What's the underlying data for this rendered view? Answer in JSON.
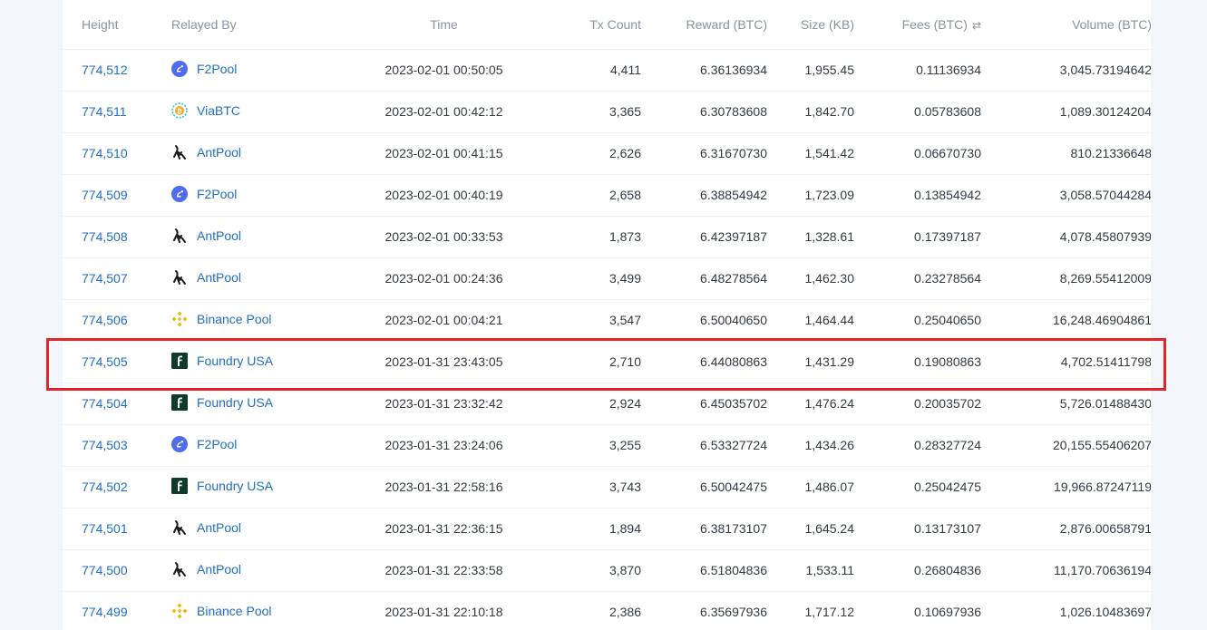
{
  "table": {
    "headers": {
      "height": "Height",
      "relayed_by": "Relayed By",
      "time": "Time",
      "tx_count": "Tx Count",
      "reward": "Reward (BTC)",
      "size": "Size (KB)",
      "fees": "Fees (BTC)",
      "volume": "Volume (BTC)"
    },
    "fees_sort_icon": "swap-arrows-icon",
    "highlighted_row_height": "774,505",
    "highlight_color": "#e0242c",
    "link_color": "#1f6fc5",
    "rows": [
      {
        "height": "774,512",
        "pool": "F2Pool",
        "pool_icon": "f2pool-icon",
        "time": "2023-02-01 00:50:05",
        "tx_count": "4,411",
        "reward": "6.36136934",
        "size": "1,955.45",
        "fees": "0.11136934",
        "volume": "3,045.73194642"
      },
      {
        "height": "774,511",
        "pool": "ViaBTC",
        "pool_icon": "viabtc-icon",
        "time": "2023-02-01 00:42:12",
        "tx_count": "3,365",
        "reward": "6.30783608",
        "size": "1,842.70",
        "fees": "0.05783608",
        "volume": "1,089.30124204"
      },
      {
        "height": "774,510",
        "pool": "AntPool",
        "pool_icon": "antpool-icon",
        "time": "2023-02-01 00:41:15",
        "tx_count": "2,626",
        "reward": "6.31670730",
        "size": "1,541.42",
        "fees": "0.06670730",
        "volume": "810.21336648"
      },
      {
        "height": "774,509",
        "pool": "F2Pool",
        "pool_icon": "f2pool-icon",
        "time": "2023-02-01 00:40:19",
        "tx_count": "2,658",
        "reward": "6.38854942",
        "size": "1,723.09",
        "fees": "0.13854942",
        "volume": "3,058.57044284"
      },
      {
        "height": "774,508",
        "pool": "AntPool",
        "pool_icon": "antpool-icon",
        "time": "2023-02-01 00:33:53",
        "tx_count": "1,873",
        "reward": "6.42397187",
        "size": "1,328.61",
        "fees": "0.17397187",
        "volume": "4,078.45807939"
      },
      {
        "height": "774,507",
        "pool": "AntPool",
        "pool_icon": "antpool-icon",
        "time": "2023-02-01 00:24:36",
        "tx_count": "3,499",
        "reward": "6.48278564",
        "size": "1,462.30",
        "fees": "0.23278564",
        "volume": "8,269.55412009"
      },
      {
        "height": "774,506",
        "pool": "Binance Pool",
        "pool_icon": "binance-pool-icon",
        "time": "2023-02-01 00:04:21",
        "tx_count": "3,547",
        "reward": "6.50040650",
        "size": "1,464.44",
        "fees": "0.25040650",
        "volume": "16,248.46904861"
      },
      {
        "height": "774,505",
        "pool": "Foundry USA",
        "pool_icon": "foundry-usa-icon",
        "time": "2023-01-31 23:43:05",
        "tx_count": "2,710",
        "reward": "6.44080863",
        "size": "1,431.29",
        "fees": "0.19080863",
        "volume": "4,702.51411798"
      },
      {
        "height": "774,504",
        "pool": "Foundry USA",
        "pool_icon": "foundry-usa-icon",
        "time": "2023-01-31 23:32:42",
        "tx_count": "2,924",
        "reward": "6.45035702",
        "size": "1,476.24",
        "fees": "0.20035702",
        "volume": "5,726.01488430"
      },
      {
        "height": "774,503",
        "pool": "F2Pool",
        "pool_icon": "f2pool-icon",
        "time": "2023-01-31 23:24:06",
        "tx_count": "3,255",
        "reward": "6.53327724",
        "size": "1,434.26",
        "fees": "0.28327724",
        "volume": "20,155.55406207"
      },
      {
        "height": "774,502",
        "pool": "Foundry USA",
        "pool_icon": "foundry-usa-icon",
        "time": "2023-01-31 22:58:16",
        "tx_count": "3,743",
        "reward": "6.50042475",
        "size": "1,486.07",
        "fees": "0.25042475",
        "volume": "19,966.87247119"
      },
      {
        "height": "774,501",
        "pool": "AntPool",
        "pool_icon": "antpool-icon",
        "time": "2023-01-31 22:36:15",
        "tx_count": "1,894",
        "reward": "6.38173107",
        "size": "1,645.24",
        "fees": "0.13173107",
        "volume": "2,876.00658791"
      },
      {
        "height": "774,500",
        "pool": "AntPool",
        "pool_icon": "antpool-icon",
        "time": "2023-01-31 22:33:58",
        "tx_count": "3,870",
        "reward": "6.51804836",
        "size": "1,533.11",
        "fees": "0.26804836",
        "volume": "11,170.70636194"
      },
      {
        "height": "774,499",
        "pool": "Binance Pool",
        "pool_icon": "binance-pool-icon",
        "time": "2023-01-31 22:10:18",
        "tx_count": "2,386",
        "reward": "6.35697936",
        "size": "1,717.12",
        "fees": "0.10697936",
        "volume": "1,026.10483697"
      }
    ]
  }
}
